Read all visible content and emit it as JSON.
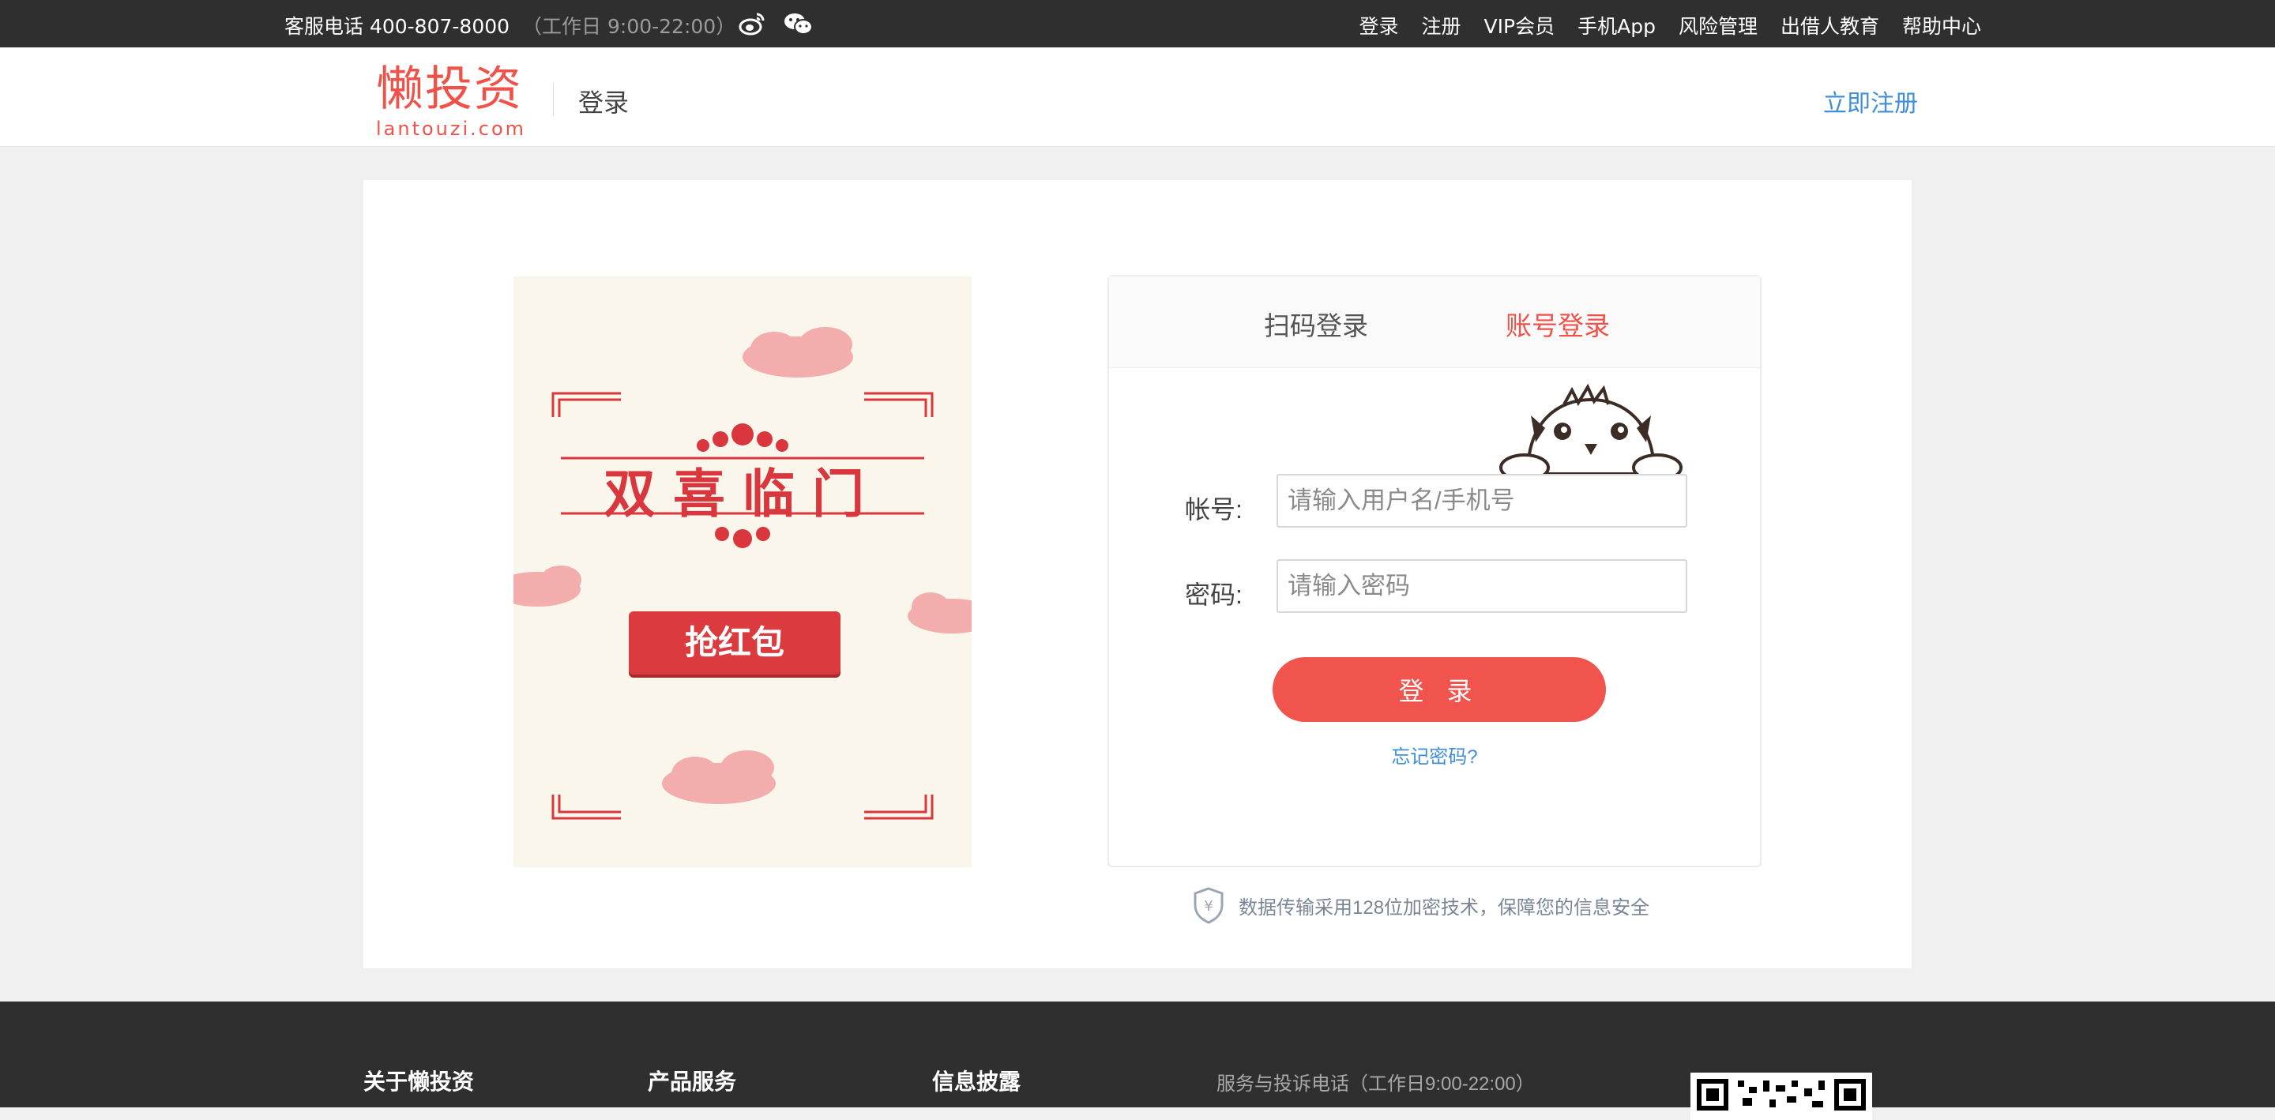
{
  "topbar": {
    "phone_label": "客服电话 400-807-8000",
    "hours": "（工作日 9:00-22:00）",
    "nav": [
      "登录",
      "注册",
      "VIP会员",
      "手机App",
      "风险管理",
      "出借人教育",
      "帮助中心"
    ]
  },
  "header": {
    "logo_cn": "懒投资",
    "logo_en": "lantouzi.com",
    "page_label": "登录",
    "register_link": "立即注册"
  },
  "promo": {
    "title": "双喜临门",
    "button": "抢红包"
  },
  "login": {
    "tabs": [
      "扫码登录",
      "账号登录"
    ],
    "active_tab": "账号登录",
    "account_label": "帐号:",
    "account_placeholder": "请输入用户名/手机号",
    "account_value": "",
    "password_label": "密码:",
    "password_placeholder": "请输入密码",
    "password_value": "",
    "submit": "登 录",
    "forgot": "忘记密码?"
  },
  "security_note": "数据传输采用128位加密技术，保障您的信息安全",
  "footer": {
    "columns": [
      "关于懒投资",
      "产品服务",
      "信息披露"
    ],
    "service_tel": "服务与投诉电话（工作日9:00-22:00）"
  },
  "colors": {
    "brand": "#f0524a",
    "link": "#3e8ed8",
    "topbar_bg": "#2f2f2f"
  },
  "icons": {
    "weibo": "weibo-icon",
    "wechat": "wechat-icon",
    "shield": "shield-icon",
    "mascot": "mascot-icon",
    "qr": "qr-code-icon"
  }
}
